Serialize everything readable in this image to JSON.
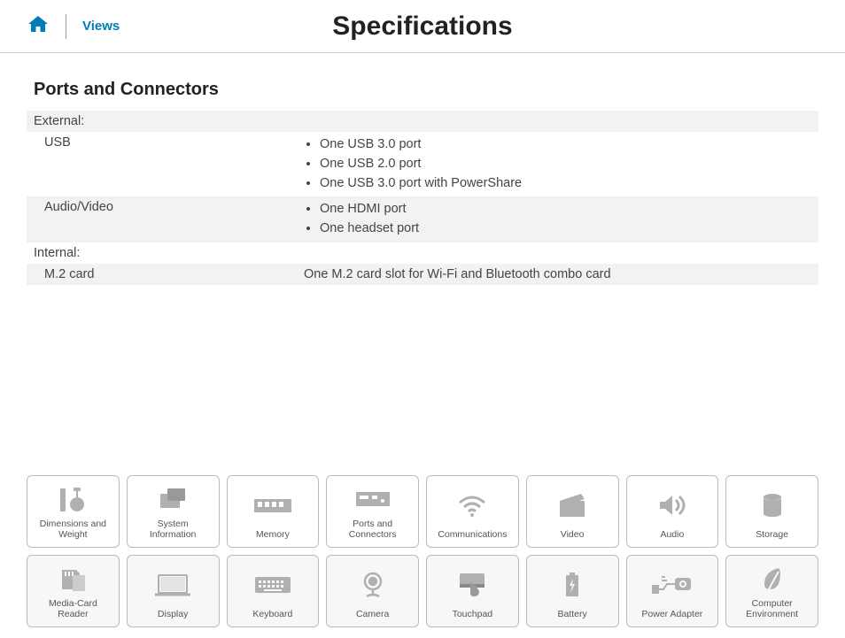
{
  "header": {
    "views_label": "Views",
    "title": "Specifications"
  },
  "section": {
    "title": "Ports and Connectors",
    "groups": [
      {
        "heading": "External:",
        "rows": [
          {
            "label": "USB",
            "items": [
              "One USB 3.0 port",
              "One USB 2.0 port",
              "One USB 3.0 port with PowerShare"
            ],
            "grey": false
          },
          {
            "label": "Audio/Video",
            "items": [
              "One HDMI port",
              "One headset port"
            ],
            "grey": true
          }
        ]
      },
      {
        "heading": "Internal:",
        "rows": [
          {
            "label": "M.2 card",
            "text": "One M.2 card slot for Wi-Fi and Bluetooth combo card",
            "grey": true
          }
        ]
      }
    ]
  },
  "nav": [
    {
      "id": "dimensions",
      "label": "Dimensions and\nWeight"
    },
    {
      "id": "system-info",
      "label": "System\nInformation"
    },
    {
      "id": "memory",
      "label": "Memory"
    },
    {
      "id": "ports",
      "label": "Ports and\nConnectors"
    },
    {
      "id": "communications",
      "label": "Communications"
    },
    {
      "id": "video",
      "label": "Video"
    },
    {
      "id": "audio",
      "label": "Audio"
    },
    {
      "id": "storage",
      "label": "Storage"
    },
    {
      "id": "media-card",
      "label": "Media-Card\nReader"
    },
    {
      "id": "display",
      "label": "Display"
    },
    {
      "id": "keyboard",
      "label": "Keyboard"
    },
    {
      "id": "camera",
      "label": "Camera"
    },
    {
      "id": "touchpad",
      "label": "Touchpad"
    },
    {
      "id": "battery",
      "label": "Battery"
    },
    {
      "id": "power-adapter",
      "label": "Power Adapter"
    },
    {
      "id": "environment",
      "label": "Computer\nEnvironment"
    }
  ]
}
